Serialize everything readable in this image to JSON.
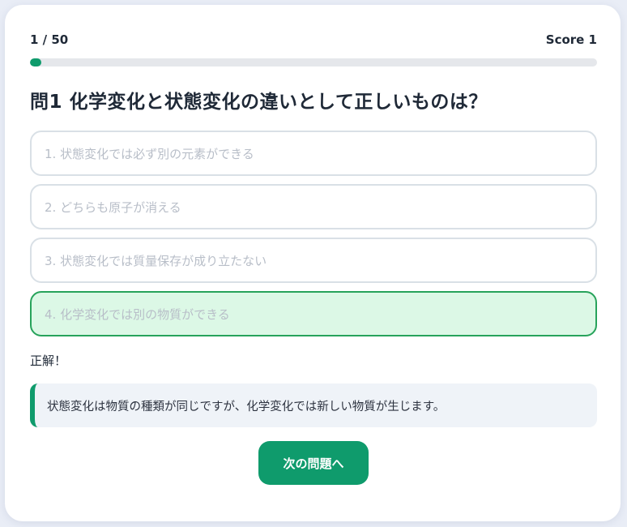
{
  "header": {
    "counter": "1 / 50",
    "score": "Score 1"
  },
  "progress": {
    "fraction": 0.02
  },
  "question": {
    "text": "問1 化学変化と状態変化の違いとして正しいものは？"
  },
  "options": [
    {
      "label": "1. 状態変化では必ず別の元素ができる",
      "state": "default"
    },
    {
      "label": "2. どちらも原子が消える",
      "state": "default"
    },
    {
      "label": "3. 状態変化では質量保存が成り立たない",
      "state": "default"
    },
    {
      "label": "4. 化学変化では別の物質ができる",
      "state": "correct"
    }
  ],
  "result": {
    "text": "正解！"
  },
  "explanation": {
    "text": "状態変化は物質の種類が同じですが、化学変化では新しい物質が生じます。"
  },
  "next_button": {
    "label": "次の問題へ"
  },
  "colors": {
    "accent": "#0f9b6c",
    "correct_bg": "#dcf8e6",
    "correct_border": "#27a35b"
  }
}
